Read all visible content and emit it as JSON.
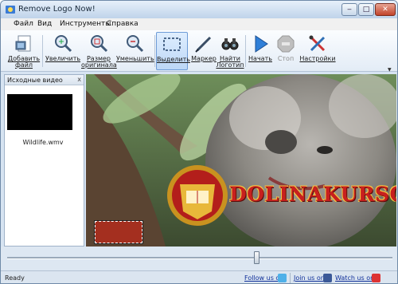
{
  "window": {
    "title": "Remove Logo Now!",
    "controls": {
      "minimize": "‒",
      "maximize": "□",
      "close": "✕"
    }
  },
  "menu": {
    "items": [
      "Файл",
      "Вид",
      "Инструменты",
      "Справка"
    ]
  },
  "toolbar": {
    "add_file": {
      "line1": "Добавить",
      "line2": "файл",
      "icon": "add-file-icon"
    },
    "zoom_in": {
      "line1": "Увеличить",
      "line2": "",
      "icon": "zoom-in-icon"
    },
    "original_size": {
      "line1": "Размер",
      "line2": "оригинала",
      "icon": "original-size-icon"
    },
    "zoom_out": {
      "line1": "Уменьшить",
      "line2": "",
      "icon": "zoom-out-icon"
    },
    "select": {
      "line1": "Выделить",
      "line2": "",
      "icon": "select-rect-icon"
    },
    "marker": {
      "line1": "Маркер",
      "line2": "",
      "icon": "marker-icon"
    },
    "find_logo": {
      "line1": "Найти",
      "line2": "Логотип",
      "icon": "binoculars-icon"
    },
    "start": {
      "line1": "Начать",
      "line2": "",
      "icon": "play-icon"
    },
    "stop": {
      "line1": "Стоп",
      "line2": "",
      "icon": "stop-icon"
    },
    "settings": {
      "line1": "Настройки",
      "line2": "",
      "icon": "settings-icon"
    }
  },
  "source_panel": {
    "title": "Исходные видео",
    "close": "x",
    "items": [
      {
        "label": "Wildlife.wmv"
      }
    ]
  },
  "video": {
    "overlay_logo_text": "DOLINAKURSOV"
  },
  "slider": {
    "position": 0.65
  },
  "statusbar": {
    "status": "Ready",
    "follow": "Follow us on",
    "join": "Join us on",
    "watch": "Watch us on"
  },
  "colors": {
    "accent": "#2f7fd8",
    "window_bg": "#d7e4f2",
    "stop_disabled": "#b5b5b5",
    "logo_red": "#c8201e",
    "logo_gold": "#f4c542"
  }
}
